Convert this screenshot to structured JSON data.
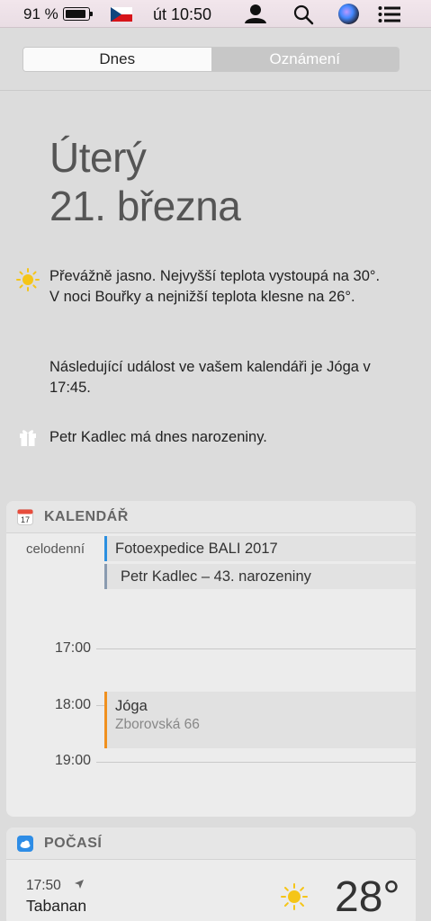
{
  "menubar": {
    "battery_text": "91 %",
    "battery_level": 0.91,
    "clock": "út 10:50",
    "icons": [
      "battery-icon",
      "czech-flag-icon",
      "user-icon",
      "spotlight-search-icon",
      "siri-icon",
      "notification-center-icon"
    ]
  },
  "tabs": [
    {
      "label": "Dnes",
      "active": true
    },
    {
      "label": "Oznámení",
      "active": false
    }
  ],
  "today": {
    "day_name": "Úterý",
    "date": "21. března"
  },
  "summary": {
    "weather": "Převážně jasno. Nejvyšší teplota vystoupá na 30°. V noci Bouřky a nejnižší teplota klesne na 26°.",
    "next_event": "Následující událost ve vašem kalendáři je Jóga v 17:45.",
    "birthday": "Petr Kadlec má dnes narozeniny."
  },
  "calendar": {
    "title": "KALENDÁŘ",
    "icon_day": "17",
    "allday_label": "celodenní",
    "allday_events": [
      {
        "title": "Fotoexpedice BALI 2017",
        "color": "#2b8fe0"
      },
      {
        "title": "Petr Kadlec – 43. narozeniny",
        "color": "#8a9bb0"
      }
    ],
    "hours": [
      "17:00",
      "18:00",
      "19:00"
    ],
    "event": {
      "title": "Jóga",
      "location": "Zborovská 66",
      "color": "#f0901f"
    }
  },
  "weather": {
    "title": "POČASÍ",
    "time": "17:50",
    "city": "Tabanan",
    "temperature": "28°",
    "condition_icon": "sun-icon"
  },
  "colors": {
    "background": "#dcdcdc",
    "card": "#ececec",
    "sun": "#f5c518"
  }
}
